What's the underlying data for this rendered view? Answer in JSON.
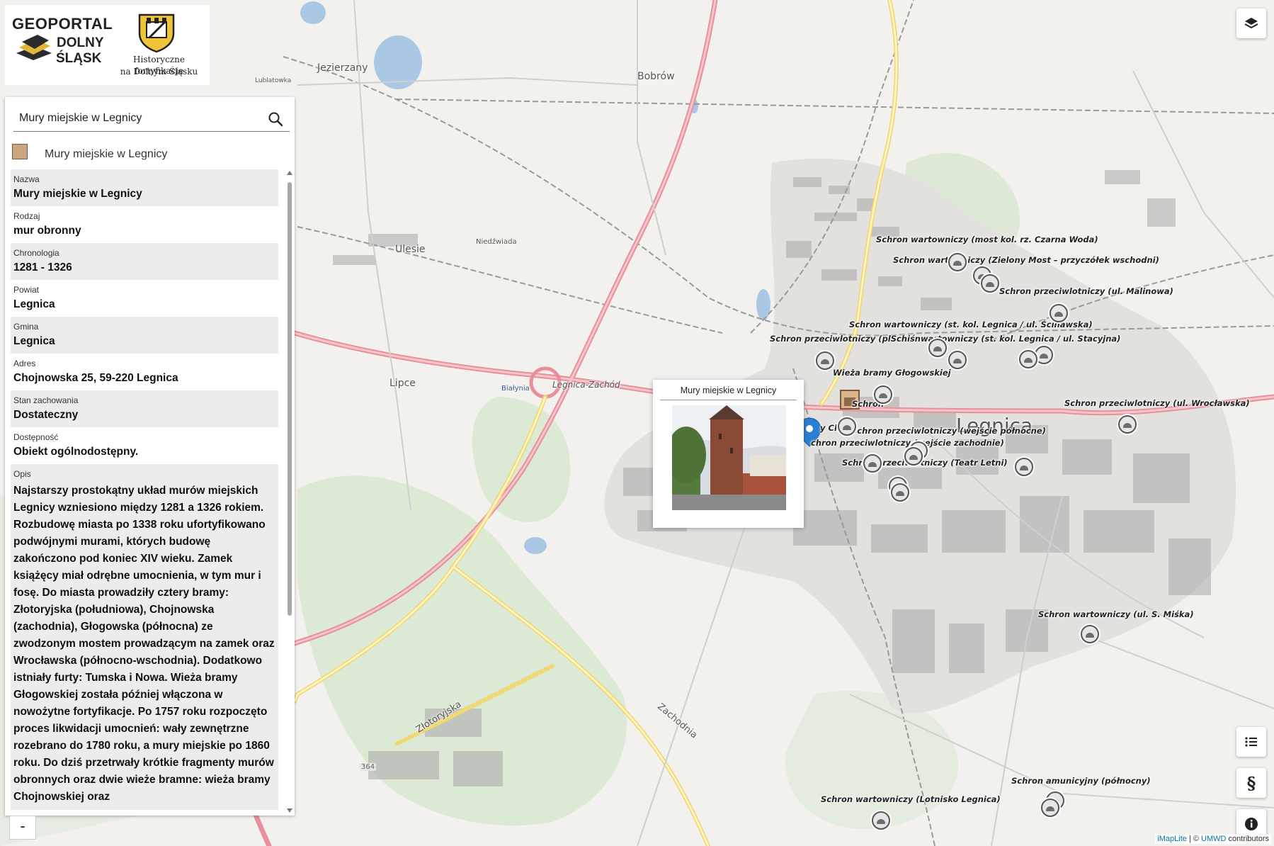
{
  "header": {
    "logo_line1": "GEOPORTAL",
    "logo_line2": "DOLNY",
    "logo_line3": "ŚLĄSK",
    "subtitle_line1": "Historyczne fortyfikacje",
    "subtitle_line2": "na Dolnym Śląsku"
  },
  "search": {
    "value": "Mury miejskie w Legnicy",
    "placeholder": ""
  },
  "result": {
    "label": "Mury miejskie w Legnicy"
  },
  "attributes": [
    {
      "key": "Nazwa",
      "value": "Mury miejskie w Legnicy"
    },
    {
      "key": "Rodzaj",
      "value": "mur obronny"
    },
    {
      "key": "Chronologia",
      "value": "1281 - 1326"
    },
    {
      "key": "Powiat",
      "value": "Legnica"
    },
    {
      "key": "Gmina",
      "value": "Legnica"
    },
    {
      "key": "Adres",
      "value": "Chojnowska 25, 59-220 Legnica"
    },
    {
      "key": "Stan zachowania",
      "value": "Dostateczny"
    },
    {
      "key": "Dostępność",
      "value": "Obiekt ogólnodostępny."
    }
  ],
  "description": {
    "key": "Opis",
    "text": "Najstarszy prostokątny układ murów miejskich Legnicy wzniesiono między 1281 a 1326 rokiem. Rozbudowę miasta po 1338 roku ufortyfikowano podwójnymi murami, których budowę zakończono pod koniec XIV wieku. Zamek książęcy miał odrębne umocnienia, w tym mur i fosę. Do miasta prowadziły cztery bramy: Złotoryjska (południowa), Chojnowska (zachodnia), Głogowska (północna) ze zwodzonym mostem prowadzącym na zamek oraz Wrocławska (północno-wschodnia). Dodatkowo istniały furty: Tumska i Nowa. Wieża bramy Głogowskiej została później włączona w nowożytne fortyfikacje. Po 1757 roku rozpoczęto proces likwidacji umocnień: wały zewnętrzne rozebrano do 1780 roku, a mury miejskie po 1860 roku. Do dziś przetrwały krótkie fragmenty murów obronnych oraz dwie wieże bramne: wieża bramy Chojnowskiej oraz"
  },
  "zoom": {
    "out_label": "-"
  },
  "popup": {
    "title": "Mury miejskie w Legnicy"
  },
  "attribution": {
    "imaplite": "iMapLite",
    "sep": " | © ",
    "umwd": "UMWD",
    "contributors": " contributors"
  },
  "map_labels": {
    "places": [
      "Jezierzany",
      "Bobrów",
      "Lublatowka",
      "Ulesie",
      "Niedźwiada",
      "Lipce",
      "Legnica-Zachód",
      "Białynia",
      "Legnica",
      "Złotoryjska",
      "Zachodnia",
      "364"
    ],
    "pois": [
      "Schron wartowniczy (most kol. rz. Czarna Woda)",
      "Schron wartowniczy (Zielony Most – przyczółek wschodni)",
      "Schron przeciwlotniczy (ul. Malinowa)",
      "Schron wartowniczy (st. kol. Legnica / ul. Ścinawska)",
      "Schron przeciwlotniczy (plSchiśnwartowniczy (st. kol. Legnica / ul. Stacyjna)",
      "Wieża bramy Głogowskiej",
      "Schron",
      "Schron przeciwlotniczy (ul. Wrocławska)",
      "y Choj",
      "Schron przeciwlotniczy (wejście północne)",
      "chron przeciwlotniczy (wejście zachodnie)",
      "Schron przeciwlotniczy (Teatr Letni)",
      "Schron wartowniczy (ul. S. Miśka)",
      "Schron amunicyjny (północny)",
      "Schron wartowniczy (Lotnisko Legnica)"
    ]
  },
  "colors": {
    "map_bg": "#f2f1ee",
    "main_road": "#e8909a",
    "secondary_road": "#f5e79e",
    "water": "#aac8e4",
    "forest": "#d6e7cf",
    "building": "#999999",
    "marker_blue": "#2a7fd4"
  }
}
